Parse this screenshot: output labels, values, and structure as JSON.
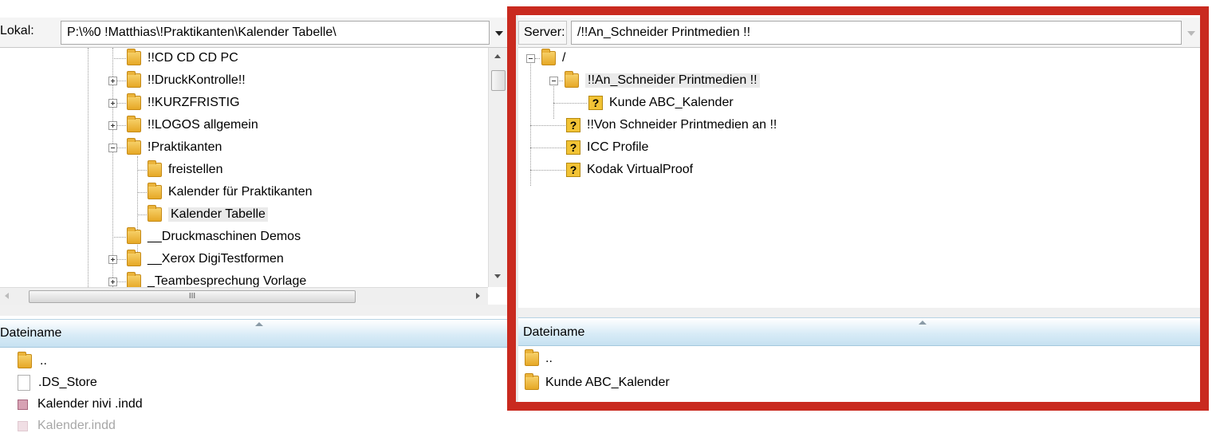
{
  "local": {
    "label": "Lokal:",
    "path": "P:\\%0 !Matthias\\!Praktikanten\\Kalender Tabelle\\",
    "tree": [
      {
        "label": "!!CD CD CD PC"
      },
      {
        "label": "!!DruckKontrolle!!"
      },
      {
        "label": "!!KURZFRISTIG"
      },
      {
        "label": "!!LOGOS allgemein"
      },
      {
        "label": "!Praktikanten"
      },
      {
        "label": "freistellen"
      },
      {
        "label": "Kalender für Praktikanten"
      },
      {
        "label": "Kalender Tabelle"
      },
      {
        "label": "__Druckmaschinen Demos"
      },
      {
        "label": "__Xerox DigiTestformen"
      },
      {
        "label": "_Teambesprechung Vorlage"
      }
    ],
    "hscroll_grip": "III",
    "list_header": "Dateiname",
    "files": [
      {
        "name": "..",
        "icon": "folder-icon"
      },
      {
        "name": ".DS_Store",
        "icon": "file-icon"
      },
      {
        "name": "Kalender nivi .indd",
        "icon": "indd-file-icon"
      },
      {
        "name": "Kalender.indd",
        "icon": "indd-file-icon"
      }
    ]
  },
  "server": {
    "label": "Server:",
    "path": "/!!An_Schneider Printmedien !!",
    "tree": [
      {
        "label": "/",
        "icon": "folder-icon"
      },
      {
        "label": "!!An_Schneider Printmedien !!",
        "icon": "folder-icon"
      },
      {
        "label": "Kunde ABC_Kalender",
        "icon": "unknown-folder-icon"
      },
      {
        "label": "!!Von Schneider Printmedien an !!",
        "icon": "unknown-folder-icon"
      },
      {
        "label": "ICC Profile",
        "icon": "unknown-folder-icon"
      },
      {
        "label": "Kodak VirtualProof",
        "icon": "unknown-folder-icon"
      }
    ],
    "unknown_glyph": "?",
    "list_header": "Dateiname",
    "files": [
      {
        "name": "..",
        "icon": "folder-icon"
      },
      {
        "name": "Kunde ABC_Kalender",
        "icon": "folder-icon"
      }
    ]
  },
  "highlight_color": "#c92a1f"
}
